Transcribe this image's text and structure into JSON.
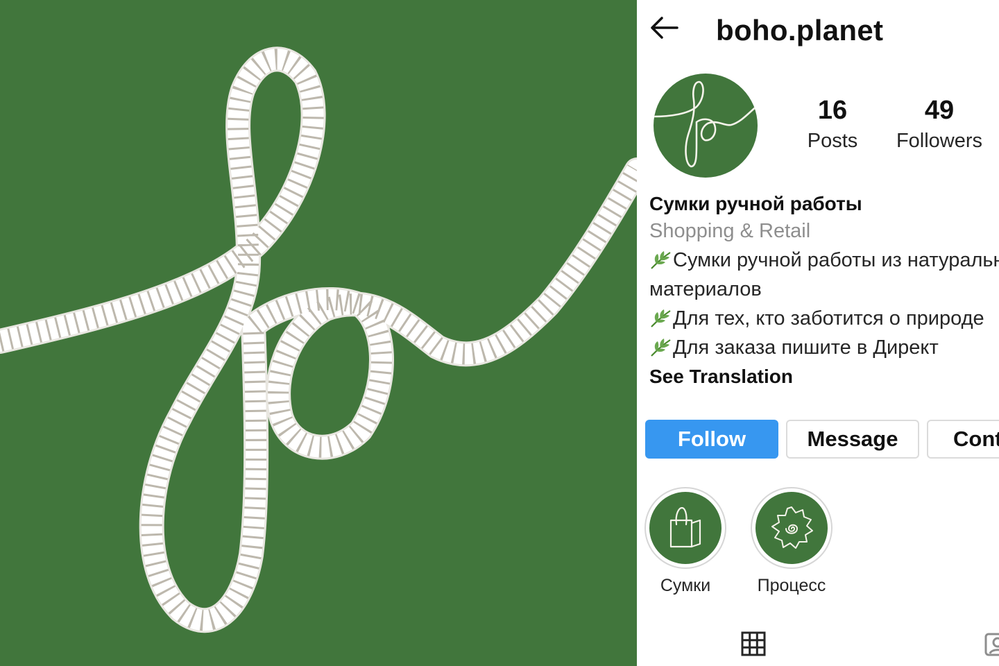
{
  "brand_panel": {
    "background_color": "#41763c",
    "rope_color": "#ffffff",
    "logo_icon": "fo-monogram-icon"
  },
  "header": {
    "username": "boho.planet",
    "back_icon": "arrow-left-icon"
  },
  "stats": {
    "posts": {
      "count": "16",
      "label": "Posts"
    },
    "followers": {
      "count": "49",
      "label": "Followers"
    }
  },
  "bio": {
    "name": "Сумки ручной работы",
    "category": "Shopping & Retail",
    "lines": [
      "Сумки ручной работы из натуральных",
      "материалов",
      "Для тех, кто заботится о природе",
      "Для заказа пишите в Директ"
    ],
    "see_translation": "See Translation"
  },
  "actions": {
    "follow": "Follow",
    "message": "Message",
    "contact": "Contact"
  },
  "highlights": [
    {
      "label": "Сумки",
      "icon": "bag-icon"
    },
    {
      "label": "Процесс",
      "icon": "gear-spiral-icon"
    }
  ],
  "tabs": {
    "grid_icon": "grid-icon",
    "tagged_icon": "tagged-icon"
  },
  "colors": {
    "accent": "#3797f0",
    "brand_green": "#41763c",
    "muted_text": "#8e8e8e"
  }
}
